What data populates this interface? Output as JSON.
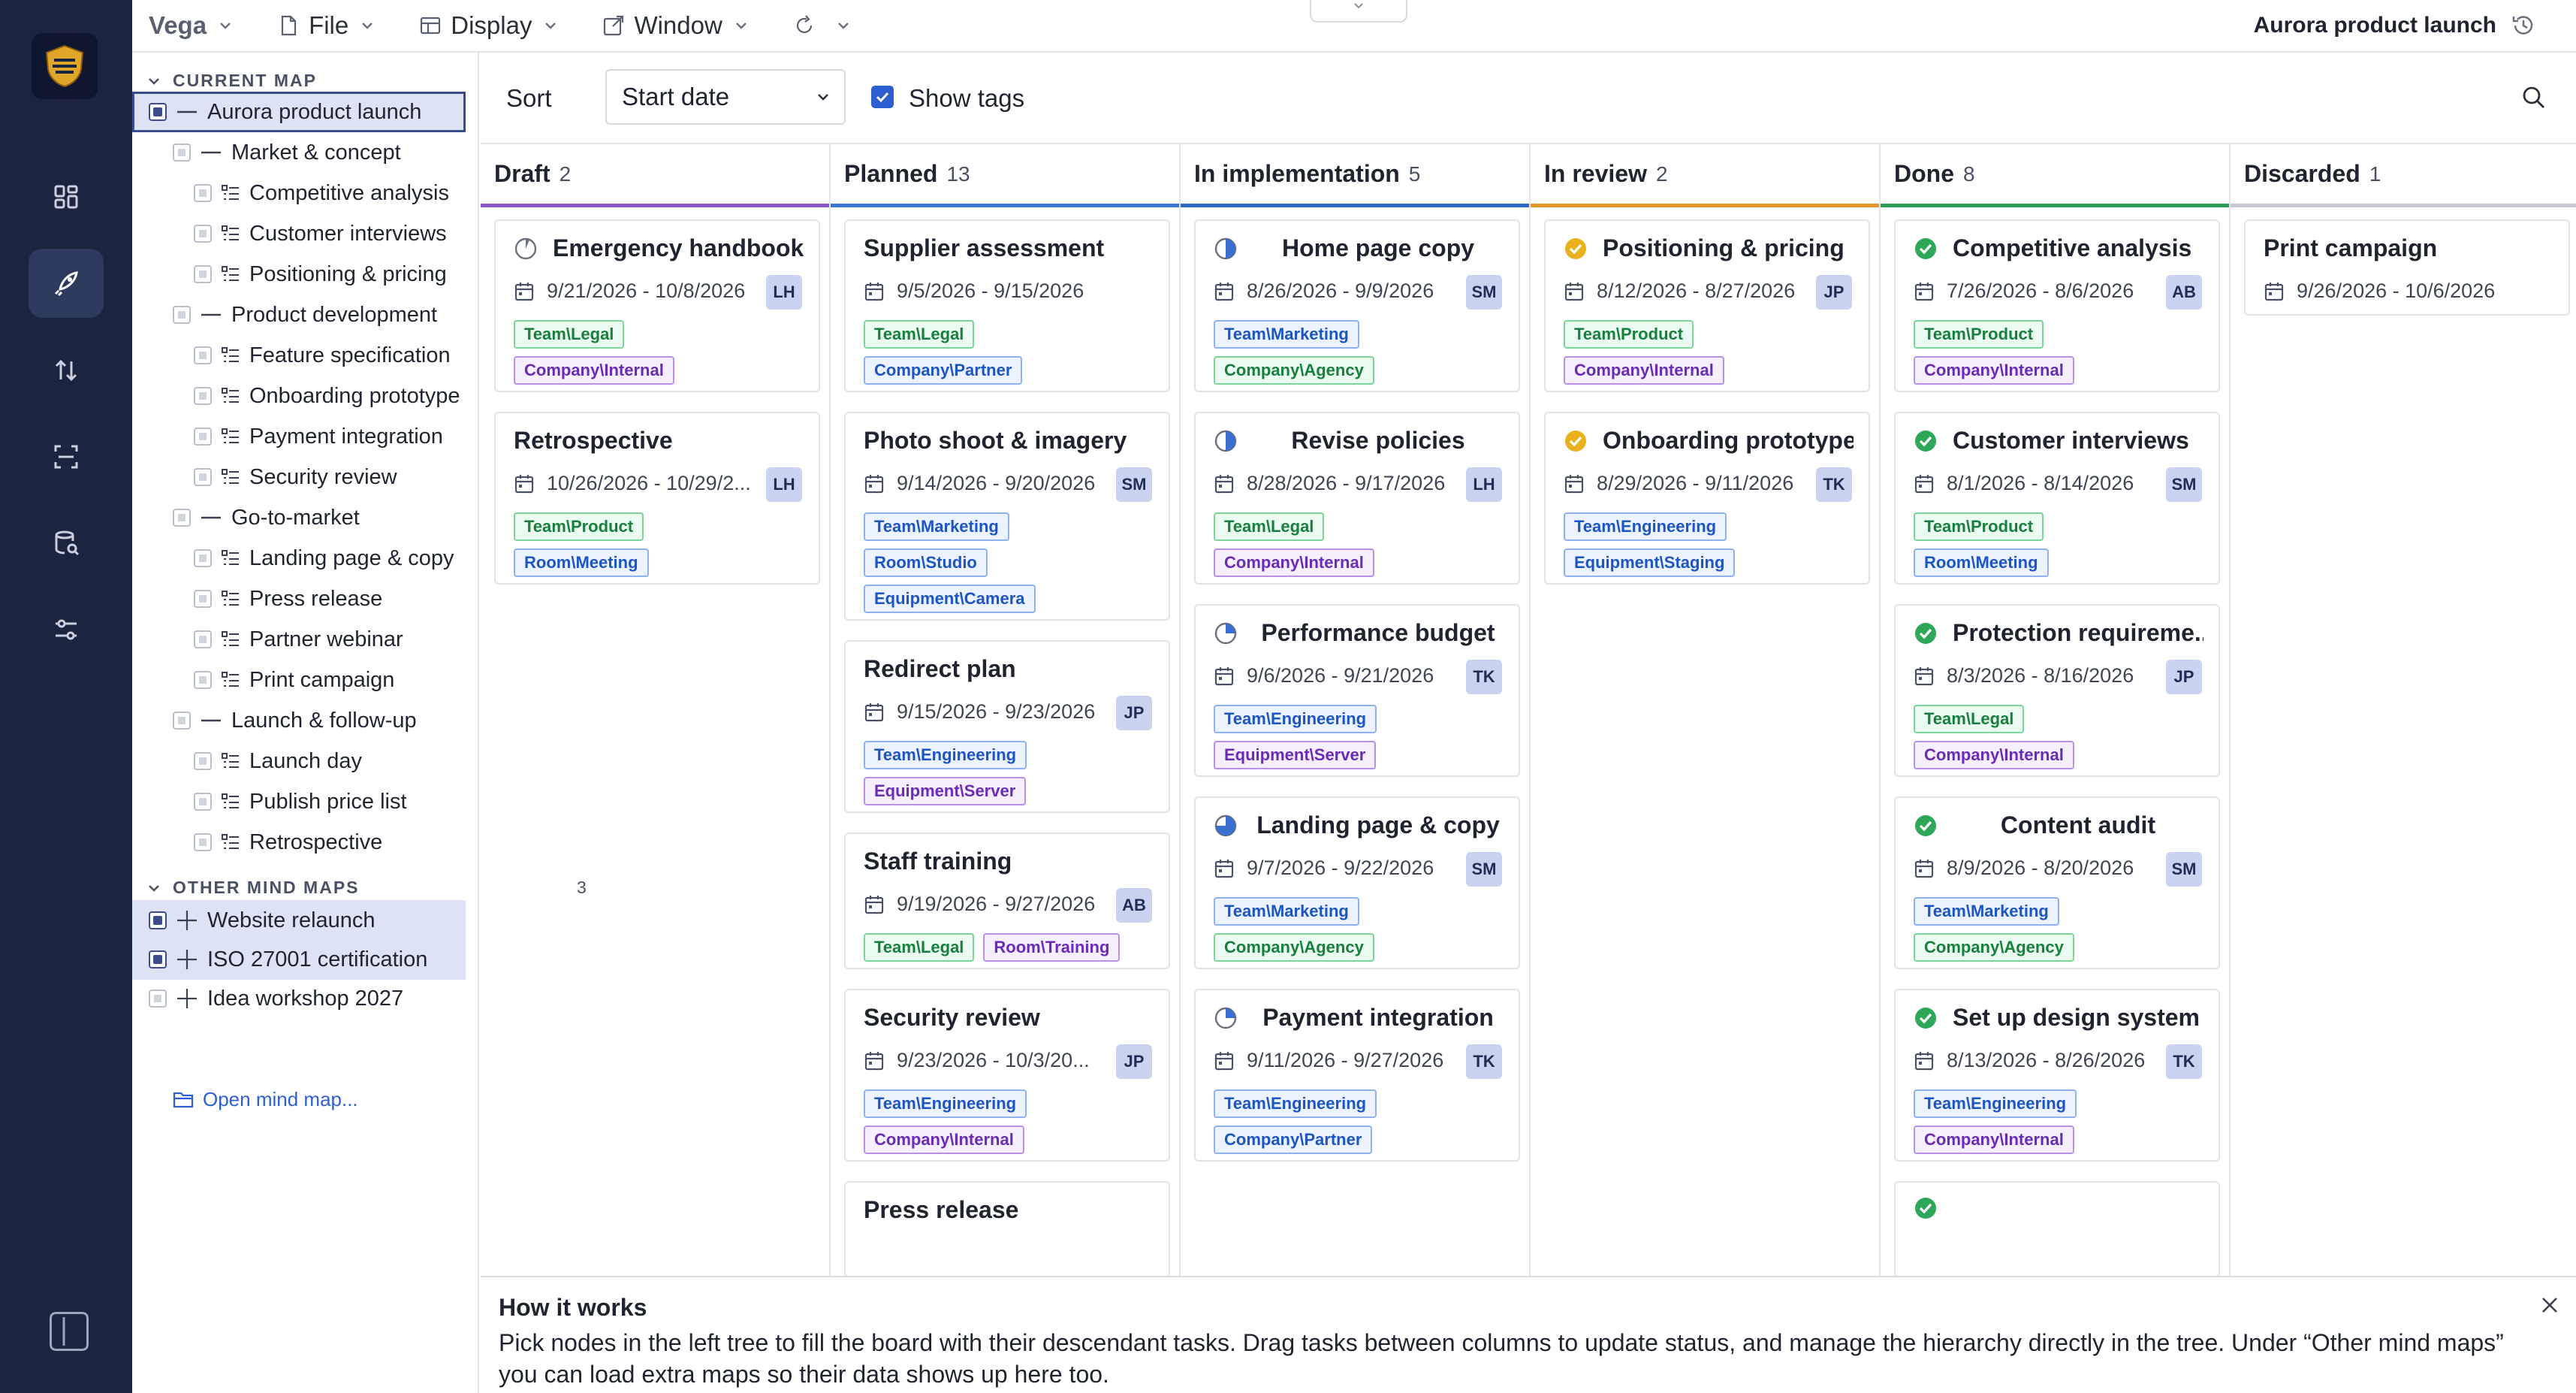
{
  "topbar": {
    "brand": "Vega",
    "menus": [
      "File",
      "Display",
      "Window"
    ],
    "map_title": "Aurora product launch"
  },
  "sidebar": {
    "current_label": "CURRENT MAP",
    "root": "Aurora product launch",
    "groups": [
      {
        "label": "Market & concept",
        "children": [
          "Competitive analysis",
          "Customer interviews",
          "Positioning & pricing"
        ]
      },
      {
        "label": "Product development",
        "children": [
          "Feature specification",
          "Onboarding prototype",
          "Payment integration",
          "Security review"
        ]
      },
      {
        "label": "Go-to-market",
        "children": [
          "Landing page & copy",
          "Press release",
          "Partner webinar",
          "Print campaign"
        ]
      },
      {
        "label": "Launch & follow-up",
        "children": [
          "Launch day",
          "Publish price list",
          "Retrospective"
        ]
      }
    ],
    "other_label": "OTHER MIND MAPS",
    "other_count": "3",
    "other_maps": [
      "Website relaunch",
      "ISO 27001 certification",
      "Idea workshop 2027"
    ],
    "open_map": "Open mind map..."
  },
  "toolbar": {
    "sort_label": "Sort",
    "sort_value": "Start date",
    "show_tags_label": "Show tags",
    "show_tags_checked": true
  },
  "columns": [
    {
      "title": "Draft",
      "count": "2",
      "color": "#8a55c9",
      "cards": [
        {
          "title": "Emergency handbook",
          "status": "draft",
          "dates": "9/21/2026 - 10/8/2026",
          "owner": "LH",
          "tags": [
            [
              "Team\\Legal",
              "green"
            ],
            [
              "Company\\Internal",
              "purple"
            ]
          ]
        },
        {
          "title": "Retrospective",
          "status": "none",
          "dates": "10/26/2026 - 10/29/2...",
          "owner": "LH",
          "tags": [
            [
              "Team\\Product",
              "green"
            ],
            [
              "Room\\Meeting",
              "blue"
            ]
          ]
        }
      ]
    },
    {
      "title": "Planned",
      "count": "13",
      "color": "#3b74d6",
      "cards": [
        {
          "title": "Supplier assessment",
          "status": "none",
          "dates": "9/5/2026 - 9/15/2026",
          "owner": "",
          "tags": [
            [
              "Team\\Legal",
              "green"
            ],
            [
              "Company\\Partner",
              "blue"
            ]
          ]
        },
        {
          "title": "Photo shoot & imagery",
          "status": "none",
          "dates": "9/14/2026 - 9/20/2026",
          "owner": "SM",
          "tags": [
            [
              "Team\\Marketing",
              "blue"
            ],
            [
              "Room\\Studio",
              "blue"
            ],
            [
              "Equipment\\Camera",
              "blue"
            ]
          ]
        },
        {
          "title": "Redirect plan",
          "status": "none",
          "dates": "9/15/2026 - 9/23/2026",
          "owner": "JP",
          "tags": [
            [
              "Team\\Engineering",
              "blue"
            ],
            [
              "Equipment\\Server",
              "purple"
            ]
          ]
        },
        {
          "title": "Staff training",
          "status": "none",
          "dates": "9/19/2026 - 9/27/2026",
          "owner": "AB",
          "tags": [
            [
              "Team\\Legal",
              "green"
            ],
            [
              "Room\\Training",
              "purple"
            ]
          ]
        },
        {
          "title": "Security review",
          "status": "none",
          "dates": "9/23/2026 - 10/3/20...",
          "owner": "JP",
          "tags": [
            [
              "Team\\Engineering",
              "blue"
            ],
            [
              "Company\\Internal",
              "purple"
            ]
          ]
        },
        {
          "title": "Press release",
          "status": "none",
          "dates": "",
          "owner": "",
          "tags": []
        }
      ]
    },
    {
      "title": "In implementation",
      "count": "5",
      "color": "#2f66c8",
      "cards": [
        {
          "title": "Home page copy",
          "status": "half",
          "dates": "8/26/2026 - 9/9/2026",
          "owner": "SM",
          "tags": [
            [
              "Team\\Marketing",
              "blue"
            ],
            [
              "Company\\Agency",
              "green"
            ]
          ]
        },
        {
          "title": "Revise policies",
          "status": "half",
          "dates": "8/28/2026 - 9/17/2026",
          "owner": "LH",
          "tags": [
            [
              "Team\\Legal",
              "green"
            ],
            [
              "Company\\Internal",
              "purple"
            ]
          ]
        },
        {
          "title": "Performance budget",
          "status": "quarter",
          "dates": "9/6/2026 - 9/21/2026",
          "owner": "TK",
          "tags": [
            [
              "Team\\Engineering",
              "blue"
            ],
            [
              "Equipment\\Server",
              "purple"
            ]
          ]
        },
        {
          "title": "Landing page & copy",
          "status": "threequarter",
          "dates": "9/7/2026 - 9/22/2026",
          "owner": "SM",
          "tags": [
            [
              "Team\\Marketing",
              "blue"
            ],
            [
              "Company\\Agency",
              "green"
            ]
          ]
        },
        {
          "title": "Payment integration",
          "status": "quarter",
          "dates": "9/11/2026 - 9/27/2026",
          "owner": "TK",
          "tags": [
            [
              "Team\\Engineering",
              "blue"
            ],
            [
              "Company\\Partner",
              "blue"
            ]
          ]
        }
      ]
    },
    {
      "title": "In review",
      "count": "2",
      "color": "#e4962b",
      "cards": [
        {
          "title": "Positioning & pricing",
          "status": "review",
          "dates": "8/12/2026 - 8/27/2026",
          "owner": "JP",
          "tags": [
            [
              "Team\\Product",
              "green"
            ],
            [
              "Company\\Internal",
              "purple"
            ]
          ]
        },
        {
          "title": "Onboarding prototype",
          "status": "review",
          "dates": "8/29/2026 - 9/11/2026",
          "owner": "TK",
          "tags": [
            [
              "Team\\Engineering",
              "blue"
            ],
            [
              "Equipment\\Staging",
              "blue"
            ]
          ]
        }
      ]
    },
    {
      "title": "Done",
      "count": "8",
      "color": "#2e9e55",
      "cards": [
        {
          "title": "Competitive analysis",
          "status": "done",
          "dates": "7/26/2026 - 8/6/2026",
          "owner": "AB",
          "tags": [
            [
              "Team\\Product",
              "green"
            ],
            [
              "Company\\Internal",
              "purple"
            ]
          ]
        },
        {
          "title": "Customer interviews",
          "status": "done",
          "dates": "8/1/2026 - 8/14/2026",
          "owner": "SM",
          "tags": [
            [
              "Team\\Product",
              "green"
            ],
            [
              "Room\\Meeting",
              "blue"
            ]
          ]
        },
        {
          "title": "Protection requireme...",
          "status": "done",
          "dates": "8/3/2026 - 8/16/2026",
          "owner": "JP",
          "tags": [
            [
              "Team\\Legal",
              "green"
            ],
            [
              "Company\\Internal",
              "purple"
            ]
          ]
        },
        {
          "title": "Content audit",
          "status": "done",
          "dates": "8/9/2026 - 8/20/2026",
          "owner": "SM",
          "tags": [
            [
              "Team\\Marketing",
              "blue"
            ],
            [
              "Company\\Agency",
              "green"
            ]
          ]
        },
        {
          "title": "Set up design system",
          "status": "done",
          "dates": "8/13/2026 - 8/26/2026",
          "owner": "TK",
          "tags": [
            [
              "Team\\Engineering",
              "blue"
            ],
            [
              "Company\\Internal",
              "purple"
            ]
          ]
        },
        {
          "title": "",
          "status": "done",
          "dates": "",
          "owner": "",
          "tags": []
        }
      ]
    },
    {
      "title": "Discarded",
      "count": "1",
      "color": "#c7cad1",
      "cards": [
        {
          "title": "Print campaign",
          "status": "none",
          "dates": "9/26/2026 - 10/6/2026",
          "owner": "",
          "tags": []
        }
      ]
    }
  ],
  "help": {
    "title": "How it works",
    "text": "Pick nodes in the left tree to fill the board with their descendant tasks. Drag tasks between columns to update status, and manage the hierarchy directly in the tree. Under “Other mind maps” you can load extra maps so their data shows up here too."
  }
}
